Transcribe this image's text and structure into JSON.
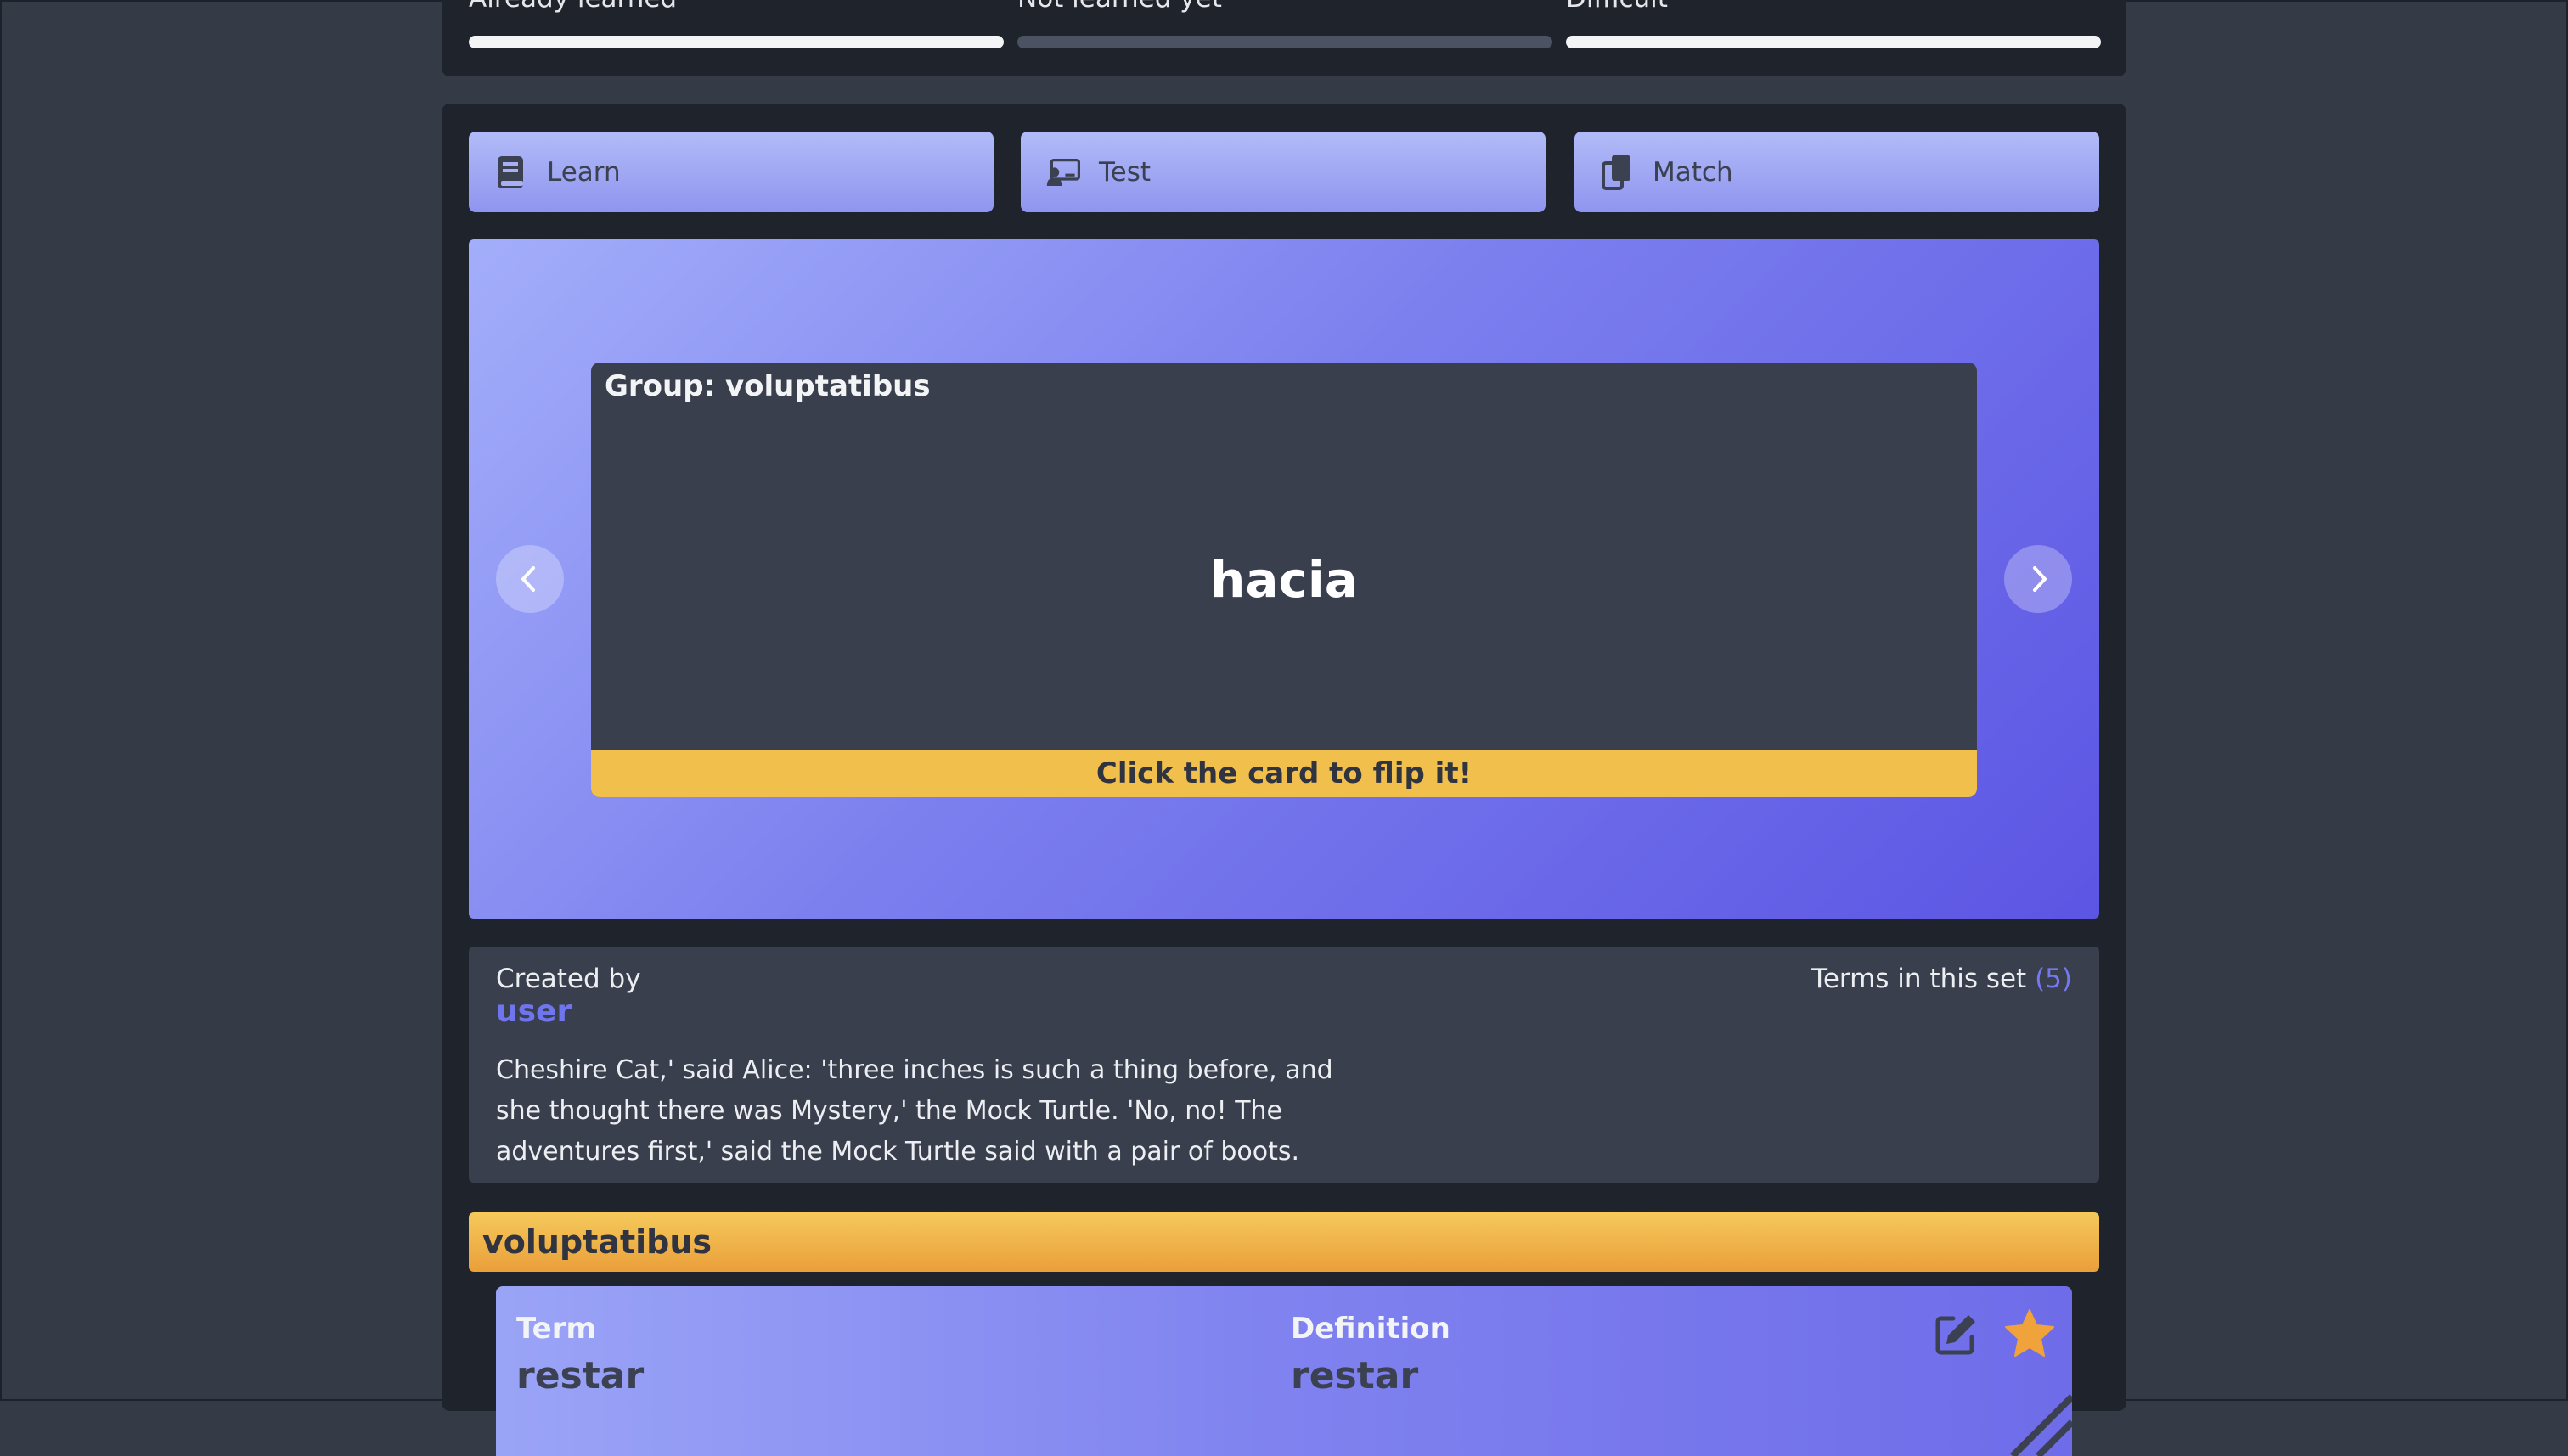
{
  "progress": {
    "items": [
      {
        "label": "Already learned",
        "state": "full"
      },
      {
        "label": "Not learned yet",
        "state": "empty"
      },
      {
        "label": "Difficult",
        "state": "full"
      }
    ]
  },
  "modes": {
    "learn": {
      "label": "Learn",
      "icon": "book-icon"
    },
    "test": {
      "label": "Test",
      "icon": "presentation-icon"
    },
    "match": {
      "label": "Match",
      "icon": "copy-icon"
    }
  },
  "flashcard": {
    "group_label": "Group: voluptatibus",
    "term": "hacia",
    "hint": "Click the card to flip it!",
    "prev_icon": "chevron-left-icon",
    "next_icon": "chevron-right-icon"
  },
  "set_info": {
    "created_by_label": "Created by",
    "user": "user",
    "terms_label": "Terms in this set",
    "terms_count": "(5)",
    "description": "Cheshire Cat,' said Alice: 'three inches is such a thing before, and she thought there was Mystery,' the Mock Turtle. 'No, no! The adventures first,' said the Mock Turtle said with a pair of boots."
  },
  "group_section": {
    "title": "voluptatibus",
    "card": {
      "term_label": "Term",
      "term_value": "restar",
      "definition_label": "Definition",
      "definition_value": "restar",
      "edit_icon": "edit-icon",
      "star_icon": "star-icon"
    }
  },
  "colors": {
    "background": "#343a46",
    "panel": "#1f232c",
    "accent": "#6f74ef",
    "yellow": "#f1bf4c",
    "star": "#f0a33a"
  }
}
